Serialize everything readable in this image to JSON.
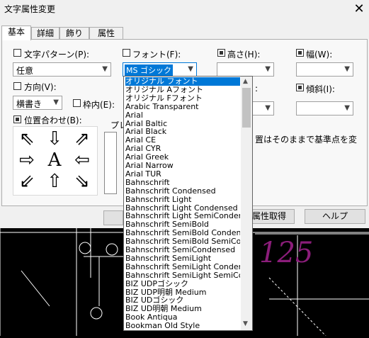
{
  "window": {
    "title": "文字属性変更",
    "close": "✕"
  },
  "tabs": [
    {
      "label": "基本",
      "active": true
    },
    {
      "label": "詳細"
    },
    {
      "label": "飾り"
    },
    {
      "label": "属性"
    }
  ],
  "fields": {
    "pattern": {
      "label": "文字パターン(P):",
      "checked": false,
      "value": "任意"
    },
    "font": {
      "label": "フォント(F):",
      "checked": false,
      "value": "MS ゴシック"
    },
    "height": {
      "label": "高さ(H):",
      "checked": true,
      "value": ""
    },
    "width": {
      "label": "幅(W):",
      "checked": true,
      "value": ""
    },
    "direction": {
      "label": "方向(V):",
      "checked": false,
      "value": "横書き"
    },
    "inner_frame": {
      "label": "枠内(E):",
      "checked": false
    },
    "spacing": {
      "label": ":",
      "value": ""
    },
    "slant": {
      "label": "傾斜(I):",
      "checked": true,
      "value": ""
    },
    "position": {
      "label": "位置合わせ(B):",
      "checked": true
    },
    "preview_label": "プレ"
  },
  "notice": "置はそのままで基準点を変",
  "buttons": {
    "get_attr": "属性取得",
    "help": "ヘルプ"
  },
  "dropdown_items": [
    "オリジナル フォント",
    "オリジナル Aフォント",
    "オリジナル Fフォント",
    "Arabic Transparent",
    "Arial",
    "Arial Baltic",
    "Arial Black",
    "Arial CE",
    "Arial CYR",
    "Arial Greek",
    "Arial Narrow",
    "Arial TUR",
    "Bahnschrift",
    "Bahnschrift Condensed",
    "Bahnschrift Light",
    "Bahnschrift Light Condensed",
    "Bahnschrift Light SemiCondensed",
    "Bahnschrift SemiBold",
    "Bahnschrift SemiBold Condensed",
    "Bahnschrift SemiBold SemiCond",
    "Bahnschrift SemiCondensed",
    "Bahnschrift SemiLight",
    "Bahnschrift SemiLight Condensed",
    "Bahnschrift SemiLight SemiCond",
    "BIZ UDPゴシック",
    "BIZ UDP明朝 Medium",
    "BIZ UDゴシック",
    "BIZ UD明朝 Medium",
    "Book Antiqua",
    "Bookman Old Style"
  ],
  "selected_index": 0,
  "cad": {
    "number": "125",
    "number_color": "#8b1d7a"
  }
}
